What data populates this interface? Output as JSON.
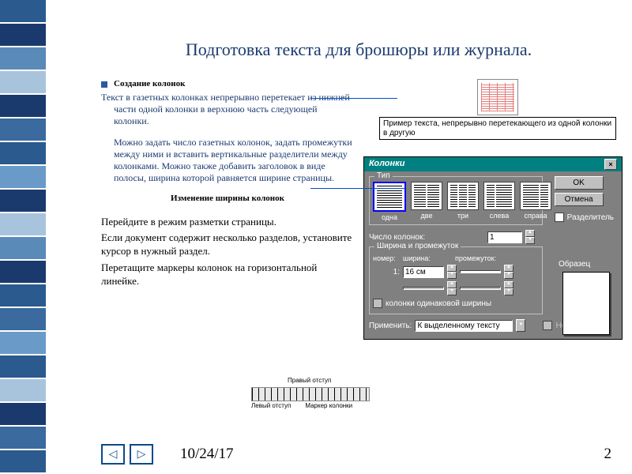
{
  "spiral_colors": [
    "#2a5a8e",
    "#1a3a6e",
    "#5a8ab8",
    "#a8c4dd",
    "#1a3a6e",
    "#3a6a9e",
    "#2a5a8e",
    "#6a9ac8",
    "#1a3a6e",
    "#a8c4dd",
    "#5a8ab8",
    "#1a3a6e",
    "#2a5a8e",
    "#3a6a9e",
    "#6a9ac8",
    "#2a5a8e",
    "#a8c4dd",
    "#1a3a6e",
    "#3a6a9e",
    "#2a5a8e"
  ],
  "title": "Подготовка текста для брошюры или журнала.",
  "section1_title": "Создание колонок",
  "para1": "Текст в газетных колонках непрерывно перетекает из нижней части одной колонки в верхнюю часть следующей колонки.",
  "para2": "Можно задать число газетных колонок, задать промежутки между ними и вставить вертикальные разделители между колонками. Можно также добавить заголовок в виде полосы, ширина которой равняется ширине страницы.",
  "section2_title": "Изменение ширины колонок",
  "body1": "Перейдите в режим разметки страницы.",
  "body2": "Если документ содержит несколько разделов, установите курсор в нужный раздел.",
  "body3": "Перетащите маркеры колонок на горизонтальной линейке.",
  "example_caption": "Пример текста, непрерывно перетекающего из одной колонки в другую",
  "dialog": {
    "title": "Колонки",
    "group_type": "Тип",
    "types": [
      "одна",
      "две",
      "три",
      "слева",
      "справа"
    ],
    "ok": "OK",
    "cancel": "Отмена",
    "divider": "Разделитель",
    "count_label": "Число колонок:",
    "count_value": "1",
    "group_width": "Ширина и промежуток",
    "col_num": "номер:",
    "col_width": "ширина:",
    "col_gap": "промежуток:",
    "num1": "1:",
    "width_val": "16 см",
    "equal": "колонки одинаковой ширины",
    "apply_label": "Применить:",
    "apply_value": "К выделенному тексту",
    "preview": "Образец",
    "newcol": "Новая колонка"
  },
  "ruler": {
    "top": "Правый отступ",
    "bl": "Левый отступ",
    "br": "Маркер колонки"
  },
  "date": "10/24/17",
  "page": "2"
}
